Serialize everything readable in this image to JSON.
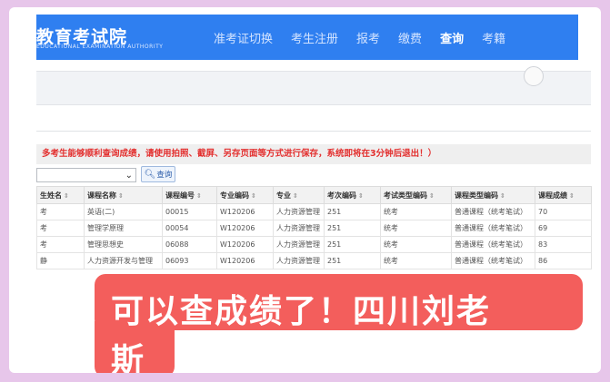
{
  "header": {
    "logo_cn": "教育考试院",
    "logo_en": "EDUCATIONAL EXAMINATION AUTHORITY",
    "nav": [
      "准考证切换",
      "考生注册",
      "报考",
      "缴费",
      "查询",
      "考籍"
    ]
  },
  "notice": "多考生能够顺利查询成绩，请使用拍照、截屏、另存页面等方式进行保存，系统即将在3分钟后退出！）",
  "filter": {
    "select_value": "",
    "query_label": "查询"
  },
  "table": {
    "columns": [
      "生姓名",
      "课程名称",
      "课程编号",
      "专业编码",
      "专业",
      "考次编码",
      "考试类型编码",
      "课程类型编码",
      "课程成绩"
    ],
    "rows": [
      [
        "考",
        "英语(二)",
        "00015",
        "W120206",
        "人力资源管理",
        "251",
        "统考",
        "普通课程（统考笔试）",
        "70"
      ],
      [
        "考",
        "管理学原理",
        "00054",
        "W120206",
        "人力资源管理",
        "251",
        "统考",
        "普通课程（统考笔试）",
        "69"
      ],
      [
        "考",
        "管理思想史",
        "06088",
        "W120206",
        "人力资源管理",
        "251",
        "统考",
        "普通课程（统考笔试）",
        "83"
      ],
      [
        "静",
        "人力资源开发与管理",
        "06093",
        "W120206",
        "人力资源管理",
        "251",
        "统考",
        "普通课程（统考笔试）",
        "86"
      ]
    ]
  },
  "caption": {
    "line1": "可以查成绩了！四川刘老",
    "line2": "斯"
  },
  "colors": {
    "header_blue": "#2f7ff0",
    "notice_red": "#e3302f",
    "caption_red": "#f35e5c",
    "border_pink": "#e7c6ea"
  }
}
